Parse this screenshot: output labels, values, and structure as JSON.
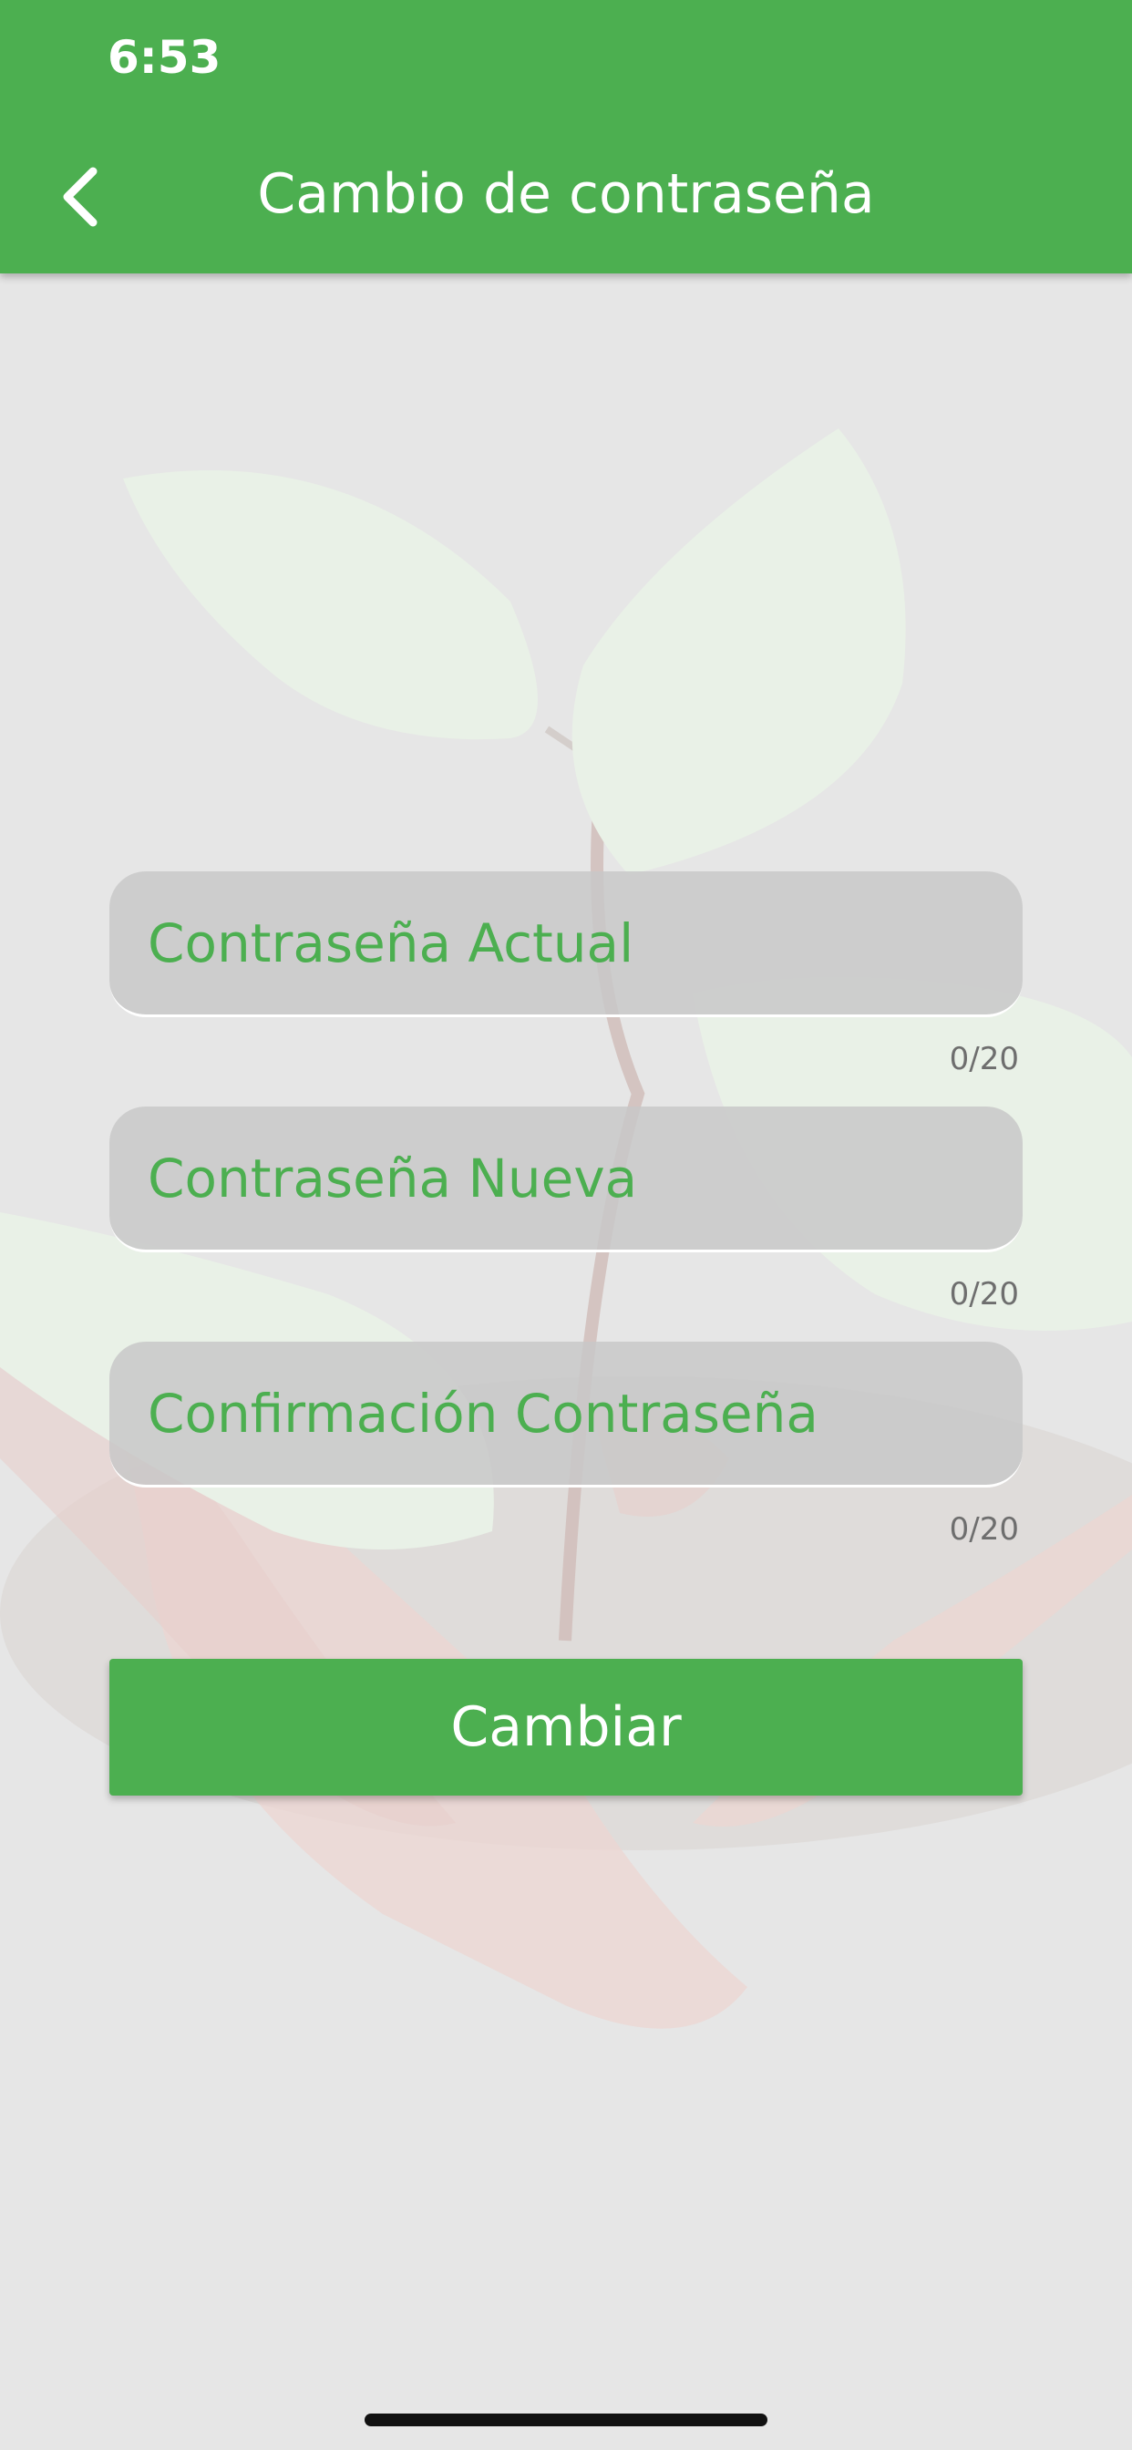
{
  "status_bar": {
    "time": "6:53"
  },
  "header": {
    "title": "Cambio de contraseña",
    "back_icon": "chevron-left-icon"
  },
  "form": {
    "fields": [
      {
        "placeholder": "Contraseña Actual",
        "value": "",
        "counter": "0/20"
      },
      {
        "placeholder": "Contraseña Nueva",
        "value": "",
        "counter": "0/20"
      },
      {
        "placeholder": "Confirmación Contraseña",
        "value": "",
        "counter": "0/20"
      }
    ],
    "submit_label": "Cambiar"
  },
  "colors": {
    "primary": "#4caf50",
    "background": "#e6e6e6",
    "field_background": "#c8c8c8",
    "counter_text": "#6e6e6e"
  }
}
